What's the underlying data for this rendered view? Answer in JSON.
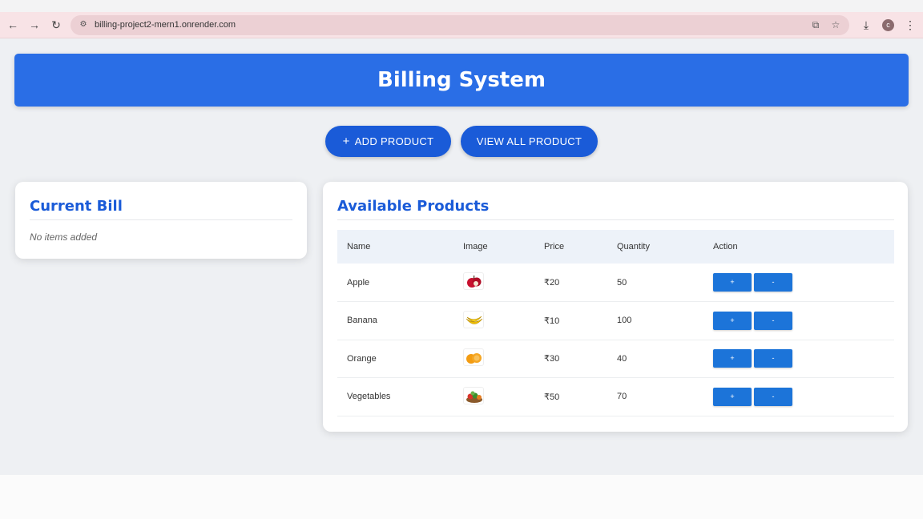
{
  "browser": {
    "url": "billing-project2-mern1.onrender.com",
    "profile_initial": "c"
  },
  "header": {
    "title": "Billing System"
  },
  "actions": {
    "add_product": "ADD PRODUCT",
    "add_icon": "+",
    "view_all": "VIEW ALL PRODUCT"
  },
  "bill": {
    "title": "Current Bill",
    "empty_text": "No items added"
  },
  "products": {
    "title": "Available Products",
    "columns": [
      "Name",
      "Image",
      "Price",
      "Quantity",
      "Action"
    ],
    "rows": [
      {
        "name": "Apple",
        "image": "apple-image",
        "price": "₹20",
        "quantity": "50",
        "plus": "+",
        "minus": "-"
      },
      {
        "name": "Banana",
        "image": "banana-image",
        "price": "₹10",
        "quantity": "100",
        "plus": "+",
        "minus": "-"
      },
      {
        "name": "Orange",
        "image": "orange-image",
        "price": "₹30",
        "quantity": "40",
        "plus": "+",
        "minus": "-"
      },
      {
        "name": "Vegetables",
        "image": "vegetables-image",
        "price": "₹50",
        "quantity": "70",
        "plus": "+",
        "minus": "-"
      }
    ]
  },
  "colors": {
    "primary": "#2a6ee6",
    "button": "#1a5bd8",
    "small_button": "#1c74d9",
    "title_text": "#1a5bd8"
  }
}
